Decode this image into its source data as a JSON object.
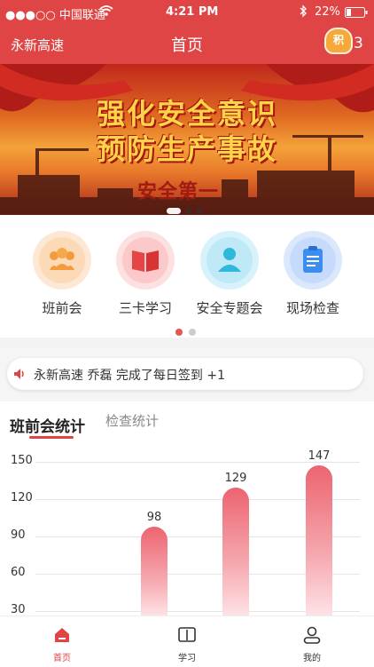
{
  "status_bar": {
    "carrier": "●●●○○ 中国联通",
    "time": "4:21 PM",
    "battery": "22%"
  },
  "nav": {
    "left_title": "永新高速",
    "title": "首页",
    "points_badge": "积",
    "points_count": "3"
  },
  "banner": {
    "title_line1": "强化安全意识",
    "title_line2": "预防生产事故",
    "subtitle": "安全第一"
  },
  "quick_actions": [
    {
      "label": "班前会",
      "icon": "group-icon",
      "color": "#f8a34b"
    },
    {
      "label": "三卡学习",
      "icon": "book-icon",
      "color": "#e84a4a"
    },
    {
      "label": "安全专题会",
      "icon": "person-icon",
      "color": "#3ec1e0"
    },
    {
      "label": "现场检查",
      "icon": "clipboard-icon",
      "color": "#3b8ef0"
    }
  ],
  "notice": {
    "text": "永新高速 乔磊 完成了每日签到 +1"
  },
  "stats_tabs": {
    "active": "班前会统计",
    "inactive": "检查统计"
  },
  "chart_data": {
    "type": "bar",
    "categories": [
      "",
      "",
      "",
      ""
    ],
    "values": [
      null,
      98,
      129,
      147
    ],
    "ylim": [
      30,
      150
    ],
    "yticks": [
      30,
      60,
      90,
      120,
      150
    ],
    "grid": true
  },
  "tabbar": {
    "home": "首页",
    "study": "学习",
    "mine": "我的"
  },
  "colors": {
    "brand": "#e04545"
  }
}
